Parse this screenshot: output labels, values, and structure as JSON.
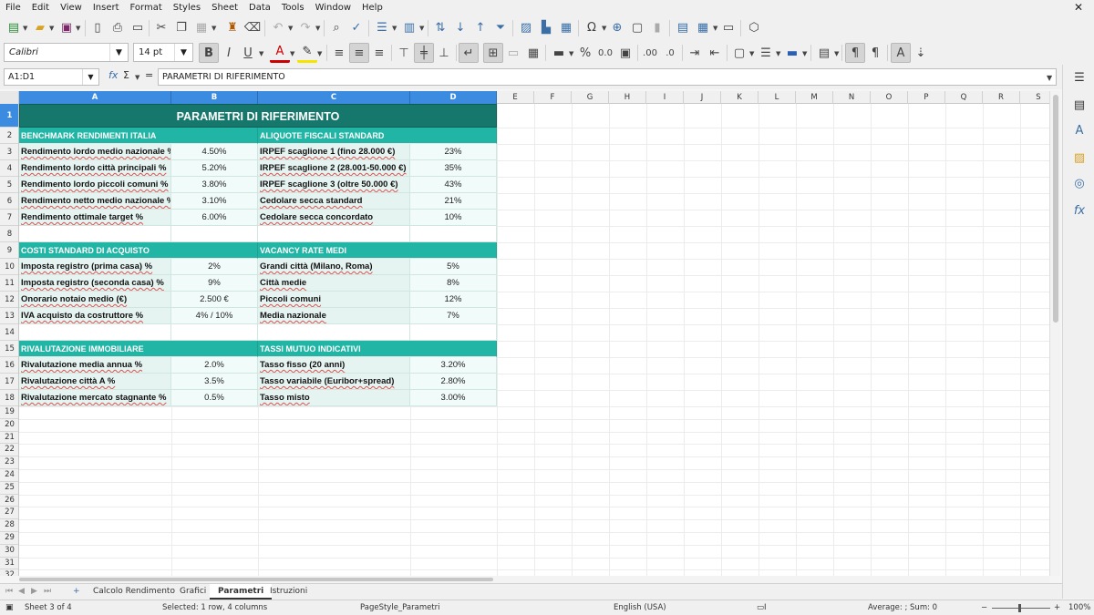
{
  "menu": [
    "File",
    "Edit",
    "View",
    "Insert",
    "Format",
    "Styles",
    "Sheet",
    "Data",
    "Tools",
    "Window",
    "Help"
  ],
  "font": {
    "name": "Calibri",
    "size": "14 pt"
  },
  "formula_bar": {
    "name_box": "A1:D1",
    "content": "PARAMETRI DI RIFERIMENTO"
  },
  "columns": [
    "A",
    "B",
    "C",
    "D",
    "E",
    "F",
    "G",
    "H",
    "I",
    "J",
    "K",
    "L",
    "M",
    "N",
    "O",
    "P",
    "Q",
    "R",
    "S"
  ],
  "rows": [
    "1",
    "2",
    "3",
    "4",
    "5",
    "6",
    "7",
    "8",
    "9",
    "10",
    "11",
    "12",
    "13",
    "14",
    "15",
    "16",
    "17",
    "18",
    "19",
    "20",
    "21",
    "22",
    "23",
    "24",
    "25",
    "26",
    "27",
    "28",
    "29",
    "30",
    "31",
    "32"
  ],
  "sheet": {
    "title": "PARAMETRI DI RIFERIMENTO",
    "sections": [
      {
        "left_header": "BENCHMARK RENDIMENTI ITALIA",
        "right_header": "ALIQUOTE FISCALI STANDARD",
        "rows": [
          {
            "label": "Rendimento lordo medio nazionale %",
            "value": "4.50%",
            "rlabel": "IRPEF scaglione 1 (fino 28.000 €)",
            "rvalue": "23%"
          },
          {
            "label": "Rendimento lordo città principali %",
            "value": "5.20%",
            "rlabel": "IRPEF scaglione 2 (28.001-50.000 €)",
            "rvalue": "35%"
          },
          {
            "label": "Rendimento lordo piccoli comuni %",
            "value": "3.80%",
            "rlabel": "IRPEF scaglione 3 (oltre 50.000 €)",
            "rvalue": "43%"
          },
          {
            "label": "Rendimento netto medio nazionale %",
            "value": "3.10%",
            "rlabel": "Cedolare secca standard",
            "rvalue": "21%"
          },
          {
            "label": "Rendimento ottimale target %",
            "value": "6.00%",
            "rlabel": "Cedolare secca concordato",
            "rvalue": "10%"
          }
        ]
      },
      {
        "left_header": "COSTI STANDARD DI ACQUISTO",
        "right_header": "VACANCY RATE MEDI",
        "rows": [
          {
            "label": "Imposta registro (prima casa) %",
            "value": "2%",
            "rlabel": "Grandi città (Milano, Roma)",
            "rvalue": "5%"
          },
          {
            "label": "Imposta registro (seconda casa) %",
            "value": "9%",
            "rlabel": "Città medie",
            "rvalue": "8%"
          },
          {
            "label": "Onorario notaio medio (€)",
            "value": "2.500 €",
            "rlabel": "Piccoli comuni",
            "rvalue": "12%"
          },
          {
            "label": "IVA acquisto da costruttore %",
            "value": "4% / 10%",
            "rlabel": "Media nazionale",
            "rvalue": "7%"
          }
        ]
      },
      {
        "left_header": "RIVALUTAZIONE IMMOBILIARE",
        "right_header": "TASSI MUTUO INDICATIVI",
        "rows": [
          {
            "label": "Rivalutazione media annua %",
            "value": "2.0%",
            "rlabel": "Tasso fisso (20 anni)",
            "rvalue": "3.20%"
          },
          {
            "label": "Rivalutazione città A %",
            "value": "3.5%",
            "rlabel": "Tasso variabile (Euribor+spread)",
            "rvalue": "2.80%"
          },
          {
            "label": "Rivalutazione mercato stagnante %",
            "value": "0.5%",
            "rlabel": "Tasso misto",
            "rvalue": "3.00%"
          }
        ]
      }
    ]
  },
  "tabs": [
    "Calcolo Rendimento",
    "Grafici",
    "Parametri",
    "Istruzioni"
  ],
  "active_tab": "Parametri",
  "status": {
    "sheet": "Sheet 3 of 4",
    "selection": "Selected: 1 row, 4 columns",
    "page_style": "PageStyle_Parametri",
    "language": "English (USA)",
    "sum": "Average: ; Sum: 0",
    "zoom": "100%"
  },
  "colors": {
    "title_bg": "#16786d",
    "section_bg": "#21b5a5",
    "label_bg": "#e6f4f1",
    "value_bg": "#f1fbf9",
    "selection": "#3b8be0"
  }
}
